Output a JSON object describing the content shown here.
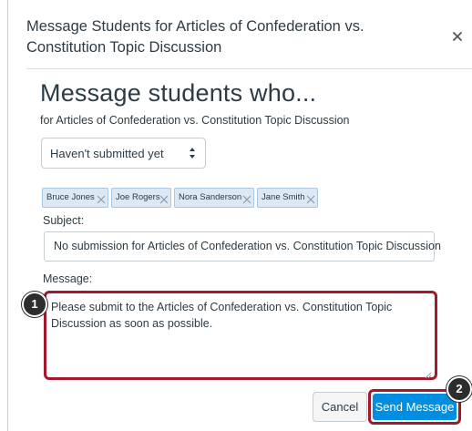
{
  "dialog": {
    "title": "Message Students for Articles of Confederation vs. Constitution Topic Discussion",
    "close_icon": "close-icon"
  },
  "form": {
    "heading": "Message students who...",
    "subheading": "for Articles of Confederation vs. Constitution Topic Discussion",
    "filter": {
      "selected": "Haven't submitted yet",
      "icon": "select-arrows-icon"
    },
    "recipients": [
      {
        "name": "Bruce Jones"
      },
      {
        "name": "Joe Rogers"
      },
      {
        "name": "Nora Sanderson"
      },
      {
        "name": "Jane Smith"
      }
    ],
    "subject_label": "Subject:",
    "subject_value": "No submission for Articles of Confederation vs. Constitution Topic Discussion",
    "message_label": "Message:",
    "message_value": "Please submit to the Articles of Confederation vs. Constitution Topic Discussion as soon as possible."
  },
  "actions": {
    "cancel_label": "Cancel",
    "send_label": "Send Message"
  },
  "callouts": {
    "first": "1",
    "second": "2"
  },
  "colors": {
    "highlight": "#a3182a",
    "primary": "#008ee2",
    "tag_bg": "#dce9f5",
    "text": "#2d3b45"
  }
}
